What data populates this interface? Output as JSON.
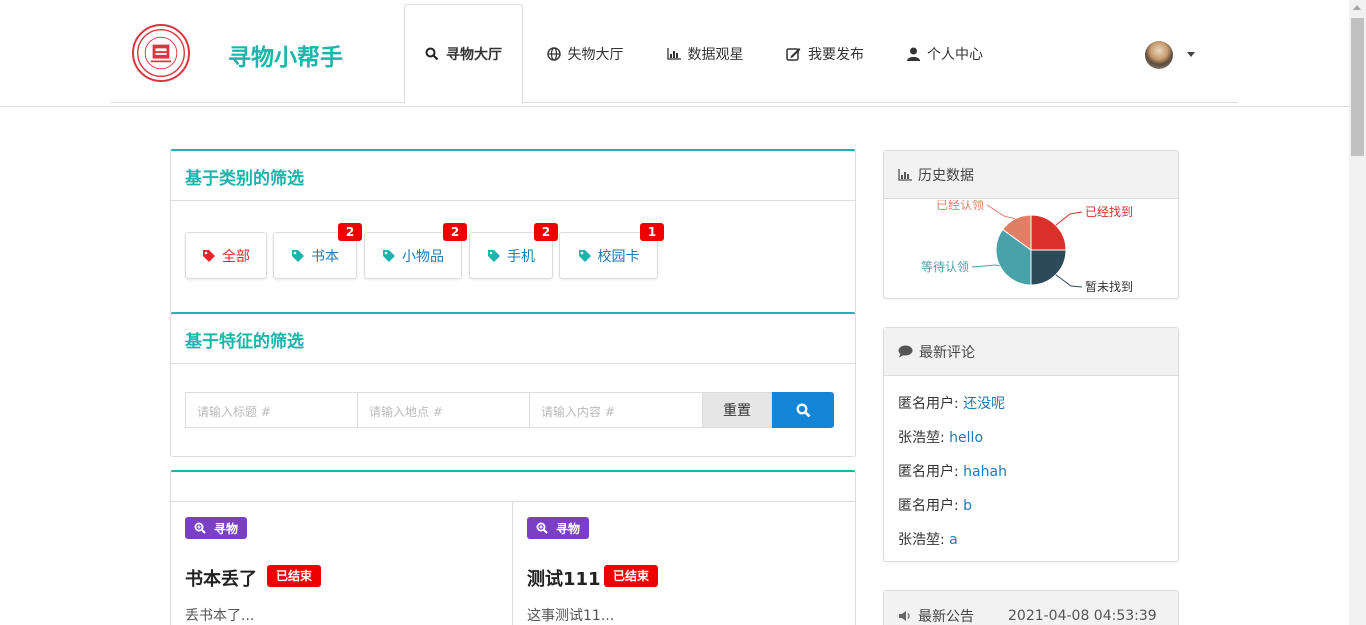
{
  "header": {
    "title": "寻物小帮手",
    "nav": [
      {
        "label": "寻物大厅",
        "icon": "search-icon",
        "active": true
      },
      {
        "label": "失物大厅",
        "icon": "globe-icon"
      },
      {
        "label": "数据观星",
        "icon": "bar-chart-icon"
      },
      {
        "label": "我要发布",
        "icon": "edit-icon"
      },
      {
        "label": "个人中心",
        "icon": "user-icon"
      }
    ]
  },
  "category_filter": {
    "title": "基于类别的筛选",
    "items": [
      {
        "label": "全部",
        "count": ""
      },
      {
        "label": "书本",
        "count": "2"
      },
      {
        "label": "小物品",
        "count": "2"
      },
      {
        "label": "手机",
        "count": "2"
      },
      {
        "label": "校园卡",
        "count": "1"
      }
    ]
  },
  "feature_filter": {
    "title": "基于特征的筛选",
    "title_placeholder": "请输入标题 #",
    "location_placeholder": "请输入地点 #",
    "content_placeholder": "请输入内容 #",
    "reset_label": "重置"
  },
  "posts": [
    {
      "type_label": "寻物",
      "title": "书本丢了",
      "status": "已结束",
      "desc": "丢书本了..."
    },
    {
      "type_label": "寻物",
      "title": "测试111",
      "status": "已结束",
      "desc": "这事测试11..."
    }
  ],
  "history": {
    "title": "历史数据",
    "colors": {
      "found": "#d9312a",
      "not_found": "#2c4a57",
      "waiting": "#49a2aa",
      "claimed": "#e07f66"
    }
  },
  "chart_data": {
    "type": "pie",
    "title": "",
    "slices": [
      {
        "label": "已经找到",
        "value": 25,
        "color": "#d9312a"
      },
      {
        "label": "暂未找到",
        "value": 25,
        "color": "#2c4a57"
      },
      {
        "label": "等待认领",
        "value": 35,
        "color": "#49a2aa"
      },
      {
        "label": "已经认领",
        "value": 15,
        "color": "#e07f66"
      }
    ]
  },
  "comments": {
    "title": "最新评论",
    "items": [
      {
        "user": "匿名用户:",
        "text": "还没呢"
      },
      {
        "user": "张浩堃:",
        "text": "hello"
      },
      {
        "user": "匿名用户:",
        "text": "hahah"
      },
      {
        "user": "匿名用户:",
        "text": "b"
      },
      {
        "user": "张浩堃:",
        "text": "a"
      }
    ]
  },
  "announcement": {
    "title": "最新公告",
    "time": "2021-04-08 04:53:39"
  }
}
